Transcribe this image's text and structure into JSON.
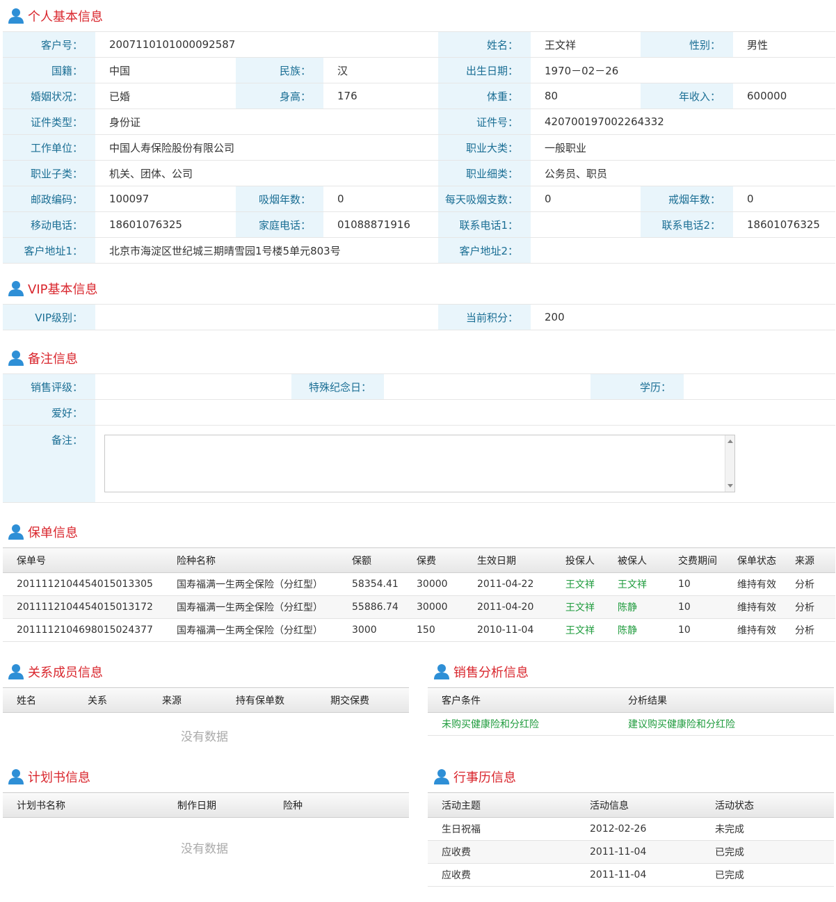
{
  "sections": {
    "personal": "个人基本信息",
    "vip": "VIP基本信息",
    "remark": "备注信息",
    "policy": "保单信息",
    "relation": "关系成员信息",
    "sales": "销售分析信息",
    "plan": "计划书信息",
    "calendar": "行事历信息"
  },
  "personal": {
    "customer_no_label": "客户号：",
    "customer_no": "2007110101000092587",
    "name_label": "姓名：",
    "name": "王文祥",
    "gender_label": "性别：",
    "gender": "男性",
    "nationality_label": "国籍：",
    "nationality": "中国",
    "ethnic_label": "民族：",
    "ethnic": "汉",
    "birth_label": "出生日期：",
    "birth": "1970－02－26",
    "marital_label": "婚姻状况：",
    "marital": "已婚",
    "height_label": "身高：",
    "height": "176",
    "weight_label": "体重：",
    "weight": "80",
    "income_label": "年收入：",
    "income": "600000",
    "idtype_label": "证件类型：",
    "idtype": "身份证",
    "idno_label": "证件号：",
    "idno": "420700197002264332",
    "employer_label": "工作单位：",
    "employer": "中国人寿保险股份有限公司",
    "occ_major_label": "职业大类：",
    "occ_major": "一般职业",
    "occ_sub_label": "职业子类：",
    "occ_sub": "机关、团体、公司",
    "occ_detail_label": "职业细类：",
    "occ_detail": "公务员、职员",
    "postcode_label": "邮政编码：",
    "postcode": "100097",
    "smoke_years_label": "吸烟年数：",
    "smoke_years": "0",
    "daily_smoke_label": "每天吸烟支数：",
    "daily_smoke": "0",
    "quit_years_label": "戒烟年数：",
    "quit_years": "0",
    "mobile_label": "移动电话：",
    "mobile": "18601076325",
    "home_phone_label": "家庭电话：",
    "home_phone": "01088871916",
    "phone1_label": "联系电话1：",
    "phone1": "",
    "phone2_label": "联系电话2：",
    "phone2": "18601076325",
    "addr1_label": "客户地址1：",
    "addr1": "北京市海淀区世纪城三期晴雪园1号楼5单元803号",
    "addr2_label": "客户地址2：",
    "addr2": ""
  },
  "vip": {
    "level_label": "VIP级别：",
    "level": "",
    "points_label": "当前积分：",
    "points": "200"
  },
  "remark": {
    "rating_label": "销售评级：",
    "rating": "",
    "anniv_label": "特殊纪念日：",
    "anniv": "",
    "edu_label": "学历：",
    "edu": "",
    "hobby_label": "爱好：",
    "hobby": "",
    "memo_label": "备注：",
    "memo": ""
  },
  "policy": {
    "headers": [
      "保单号",
      "险种名称",
      "保额",
      "保费",
      "生效日期",
      "投保人",
      "被保人",
      "交费期间",
      "保单状态",
      "来源"
    ],
    "rows": [
      [
        "2011112104454015013305",
        "国寿福满一生两全保险（分红型）",
        "58354.41",
        "30000",
        "2011-04-22",
        "王文祥",
        "王文祥",
        "10",
        "维持有效",
        "分析"
      ],
      [
        "2011112104454015013172",
        "国寿福满一生两全保险（分红型）",
        "55886.74",
        "30000",
        "2011-04-20",
        "王文祥",
        "陈静",
        "10",
        "维持有效",
        "分析"
      ],
      [
        "2011112104698015024377",
        "国寿福满一生两全保险（分红型）",
        "3000",
        "150",
        "2010-11-04",
        "王文祥",
        "陈静",
        "10",
        "维持有效",
        "分析"
      ]
    ]
  },
  "relation": {
    "headers": [
      "姓名",
      "关系",
      "来源",
      "持有保单数",
      "期交保费"
    ],
    "empty": "没有数据"
  },
  "sales": {
    "headers": [
      "客户条件",
      "分析结果"
    ],
    "rows": [
      [
        "未购买健康险和分红险",
        "建议购买健康险和分红险"
      ]
    ]
  },
  "plan": {
    "headers": [
      "计划书名称",
      "制作日期",
      "险种"
    ],
    "empty": "没有数据"
  },
  "calendar": {
    "headers": [
      "活动主题",
      "活动信息",
      "活动状态"
    ],
    "rows": [
      [
        "生日祝福",
        "2012-02-26",
        "未完成"
      ],
      [
        "应收费",
        "2011-11-04",
        "已完成"
      ],
      [
        "应收费",
        "2011-11-04",
        "已完成"
      ]
    ]
  },
  "colors": {
    "title_red": "#d9262d",
    "label_blue": "#1a6e94",
    "label_bg": "#e9f5fb",
    "link_green": "#1e9b3c"
  }
}
